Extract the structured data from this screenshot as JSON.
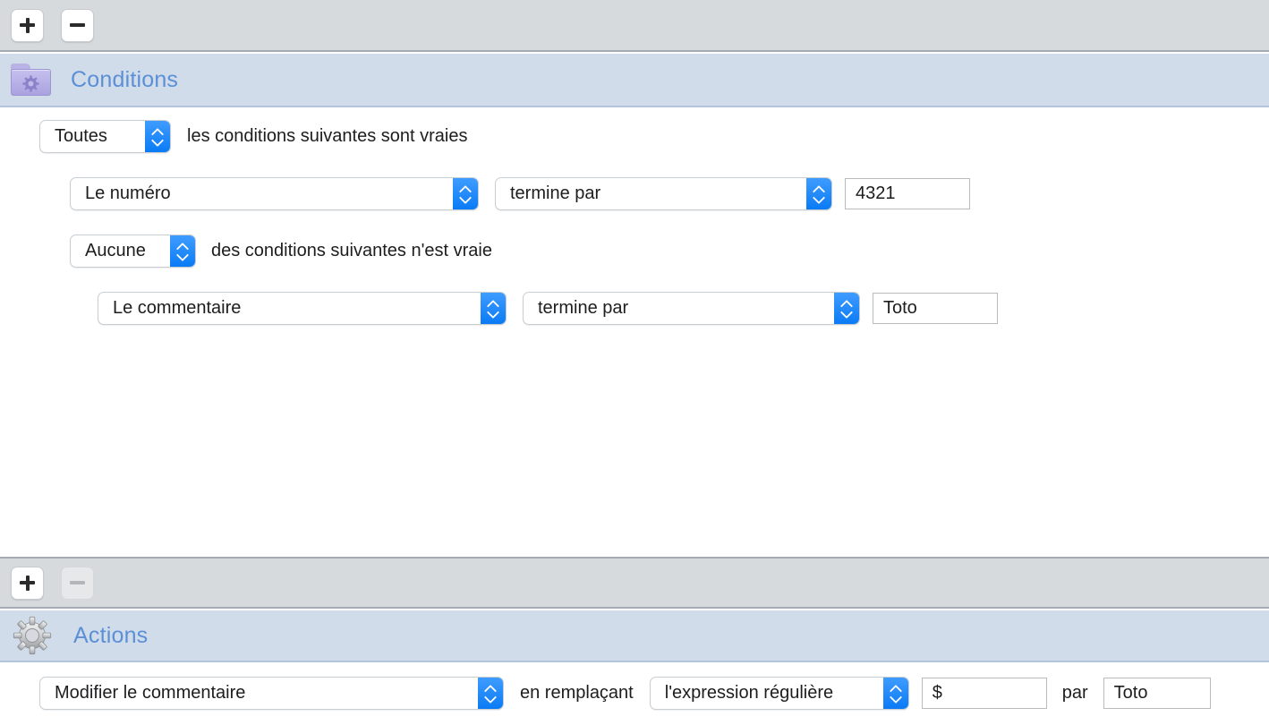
{
  "toolbars": {
    "conditions": {
      "add_label": "+",
      "remove_label": "−",
      "add_icon": "plus-icon",
      "remove_icon": "minus-icon"
    },
    "actions": {
      "add_label": "+",
      "remove_label": "−",
      "add_icon": "plus-icon",
      "remove_icon": "minus-icon",
      "remove_disabled": true
    }
  },
  "sections": {
    "conditions": {
      "title": "Conditions",
      "icon": "purple-folder-gear-icon",
      "title_color": "#5b8fd6",
      "band_color": "#d1dcea"
    },
    "actions": {
      "title": "Actions",
      "icon": "gray-gear-icon",
      "title_color": "#5b8fd6",
      "band_color": "#d1dcea"
    }
  },
  "conditions": {
    "group1": {
      "quantifier": "Toutes",
      "sentence": "les conditions suivantes sont vraies",
      "rules": [
        {
          "field": "Le numéro",
          "operator": "termine par",
          "value": "4321"
        }
      ]
    },
    "group2": {
      "quantifier": "Aucune",
      "sentence": "des conditions suivantes n'est vraie",
      "rules": [
        {
          "field": "Le commentaire",
          "operator": "termine par",
          "value": "Toto"
        }
      ]
    }
  },
  "actions": {
    "rows": [
      {
        "action": "Modifier le commentaire",
        "mid_label": "en remplaçant",
        "target": "l'expression régulière",
        "pattern": "$",
        "by_label": "par",
        "replacement": "Toto"
      }
    ]
  },
  "colors": {
    "accent_blue": "#0a7bf5",
    "toolbar_gray": "#d6dadd",
    "header_blue": "#d1dcea",
    "separator": "#a4abb2",
    "text": "#1d1d1f"
  }
}
